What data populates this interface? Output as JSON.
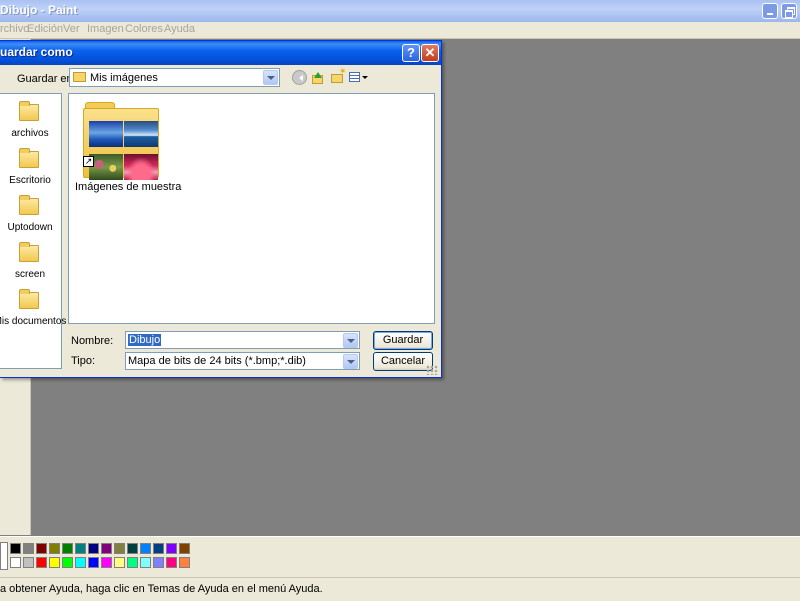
{
  "app": {
    "title": "Dibujo - Paint",
    "menus": [
      "rchivo",
      "Edición",
      "Ver",
      "Imagen",
      "Colores",
      "Ayuda"
    ]
  },
  "dialog": {
    "title": "uardar como",
    "help_glyph": "?",
    "close_glyph": "✕",
    "save_in_label": "Guardar en:",
    "save_in_value": "Mis imágenes",
    "toolbar_icons": [
      "back-icon",
      "up-folder-icon",
      "new-folder-icon",
      "views-menu-icon"
    ],
    "places": [
      {
        "label": "archivos",
        "icon": "folder-icon"
      },
      {
        "label": "Escritorio",
        "icon": "folder-icon"
      },
      {
        "label": "Uptodown",
        "icon": "folder-icon"
      },
      {
        "label": "screen",
        "icon": "folder-icon"
      },
      {
        "label": "Mis documentos",
        "icon": "folder-icon"
      }
    ],
    "files": [
      {
        "label": "Imágenes de muestra",
        "icon": "shortcut-folder-thumbnail-icon"
      }
    ],
    "name_label": "Nombre:",
    "name_value": "Dibujo",
    "type_label": "Tipo:",
    "type_value": "Mapa de bits de 24 bits (*.bmp;*.dib)",
    "save_button": "Guardar",
    "cancel_button": "Cancelar"
  },
  "palette": {
    "top_row": [
      "#000000",
      "#808080",
      "#800000",
      "#808000",
      "#008000",
      "#008080",
      "#000080",
      "#800080",
      "#808040",
      "#004040",
      "#0080ff",
      "#004080",
      "#8000ff",
      "#804000"
    ],
    "bottom_row": [
      "#ffffff",
      "#c0c0c0",
      "#ff0000",
      "#ffff00",
      "#00ff00",
      "#00ffff",
      "#0000ff",
      "#ff00ff",
      "#ffff80",
      "#00ff80",
      "#80ffff",
      "#8080ff",
      "#ff0080",
      "#ff8040"
    ]
  },
  "status": {
    "text": "a obtener Ayuda, haga clic en Temas de Ayuda en el menú Ayuda."
  }
}
